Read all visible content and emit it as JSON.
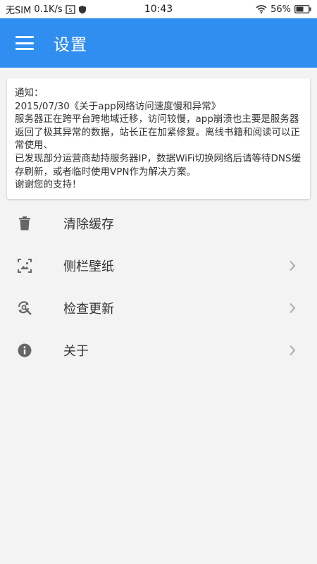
{
  "statusbar": {
    "carrier": "无SIM",
    "speed": "0.1K/s",
    "time": "10:43",
    "battery": "56%"
  },
  "appbar": {
    "title": "设置",
    "menu_icon": "hamburger-menu-icon"
  },
  "notice": {
    "lines": [
      "通知：",
      "2015/07/30《关于app网络访问速度慢和异常》",
      "服务器正在跨平台跨地域迁移，访问较慢，app崩溃也主要是服务器返回了极其异常的数据，站长正在加紧修复。离线书籍和阅读可以正常使用、",
      "已发现部分运营商劫持服务器IP，数据WiFi切换网络后请等待DNS缓存刷新，或者临时使用VPN作为解决方案。",
      "谢谢您的支持！"
    ]
  },
  "menu": {
    "items": [
      {
        "label": "清除缓存",
        "icon": "trash-icon",
        "has_chevron": false
      },
      {
        "label": "侧栏壁纸",
        "icon": "wallpaper-icon",
        "has_chevron": true
      },
      {
        "label": "检查更新",
        "icon": "refresh-search-icon",
        "has_chevron": true
      },
      {
        "label": "关于",
        "icon": "info-icon",
        "has_chevron": true
      }
    ]
  },
  "colors": {
    "primary": "#2f8ef0",
    "background": "#f3f3f3",
    "icon": "#666666",
    "chevron": "#aaaaaa"
  }
}
